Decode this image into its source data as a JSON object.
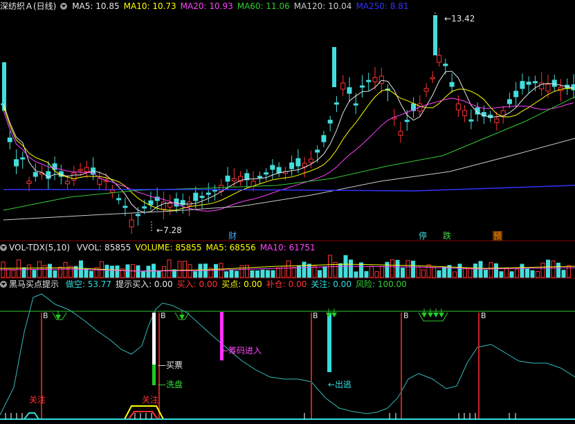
{
  "price_panel": {
    "title": "深纺织Ａ(日线)",
    "ma_labels": [
      {
        "text": "MA5: 10.85",
        "color": "#e8e8e8"
      },
      {
        "text": "MA10: 10.73",
        "color": "#ffff00"
      },
      {
        "text": "MA20: 10.93",
        "color": "#ff44ff"
      },
      {
        "text": "MA60: 11.06",
        "color": "#33cc33"
      },
      {
        "text": "MA120: 10.04",
        "color": "#cccccc"
      },
      {
        "text": "MA250: 8.81",
        "color": "#3333ff"
      }
    ],
    "high_label": "13.42",
    "low_label": "7.28",
    "event_markers": [
      {
        "text": "财",
        "color": "#44aaff"
      },
      {
        "text": "停",
        "color": "#44dddd"
      },
      {
        "text": "跌",
        "color": "#44dd44"
      },
      {
        "text": "预",
        "color": "#ff8800"
      }
    ]
  },
  "volume_panel": {
    "title": "VOL-TDX(5,10)",
    "labels": [
      {
        "text": "VVOL: 85855",
        "color": "#e8e8e8"
      },
      {
        "text": "VOLUME: 85855",
        "color": "#ffff00"
      },
      {
        "text": "MA5: 68556",
        "color": "#ffff00"
      },
      {
        "text": "MA10: 61751",
        "color": "#ff44ff"
      }
    ]
  },
  "indicator_panel": {
    "title": "黑马买点提示",
    "labels": [
      {
        "text": "做空: 53.77",
        "color": "#33dddd"
      },
      {
        "text": "提示买入: 0.00",
        "color": "#e8e8e8"
      },
      {
        "text": "买入: 0.00",
        "color": "#ff3333"
      },
      {
        "text": "买点: 0.00",
        "color": "#ffff00"
      },
      {
        "text": "补仓: 0.00",
        "color": "#ff3333"
      },
      {
        "text": "关注: 0.00",
        "color": "#33dddd"
      },
      {
        "text": "风险: 100.00",
        "color": "#33cc33"
      }
    ],
    "annotations": {
      "b_marker": "B",
      "buy_ticket": "买票",
      "wash": "洗盘",
      "chips_in": "←筹码进入",
      "escape": "←出逃",
      "watch": "关注"
    }
  }
}
